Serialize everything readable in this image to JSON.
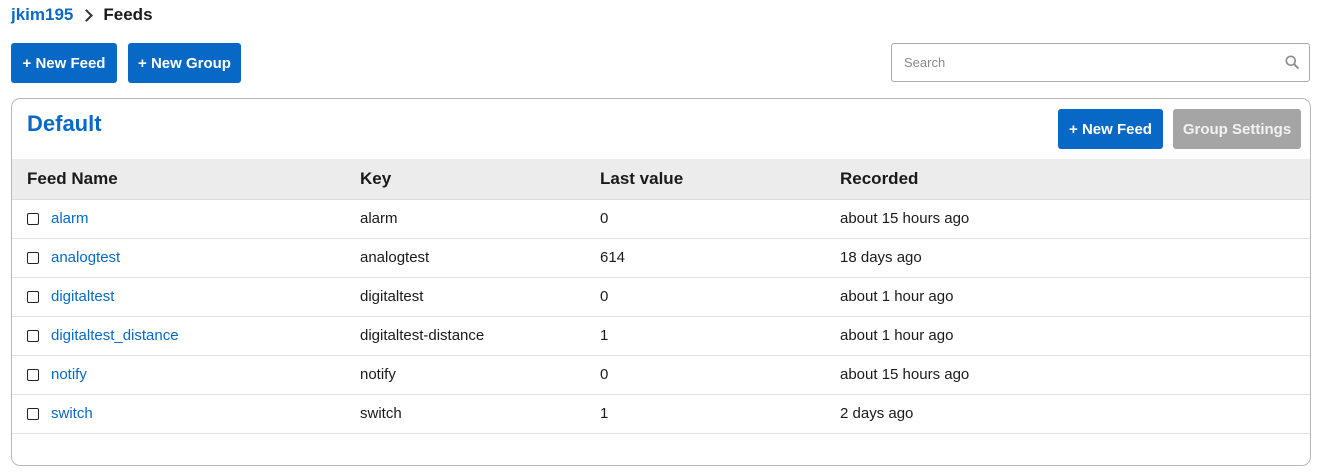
{
  "breadcrumb": {
    "user": "jkim195",
    "current": "Feeds"
  },
  "toolbar": {
    "new_feed_label": "+ New Feed",
    "new_group_label": "+ New Group"
  },
  "search": {
    "placeholder": "Search",
    "value": "",
    "icon": "search-icon"
  },
  "group": {
    "name": "Default",
    "new_feed_label": "+ New Feed",
    "settings_label": "Group Settings",
    "columns": [
      "Feed Name",
      "Key",
      "Last value",
      "Recorded"
    ],
    "rows": [
      {
        "name": "alarm",
        "key": "alarm",
        "last_value": "0",
        "recorded": "about 15 hours ago"
      },
      {
        "name": "analogtest",
        "key": "analogtest",
        "last_value": "614",
        "recorded": "18 days ago"
      },
      {
        "name": "digitaltest",
        "key": "digitaltest",
        "last_value": "0",
        "recorded": "about 1 hour ago"
      },
      {
        "name": "digitaltest_distance",
        "key": "digitaltest-distance",
        "last_value": "1",
        "recorded": "about 1 hour ago"
      },
      {
        "name": "notify",
        "key": "notify",
        "last_value": "0",
        "recorded": "about 15 hours ago"
      },
      {
        "name": "switch",
        "key": "switch",
        "last_value": "1",
        "recorded": "2 days ago"
      }
    ]
  },
  "colors": {
    "primary": "#0768c6",
    "link": "#0869c6",
    "disabled_button": "#a5a5a5",
    "header_row": "#ececec"
  }
}
